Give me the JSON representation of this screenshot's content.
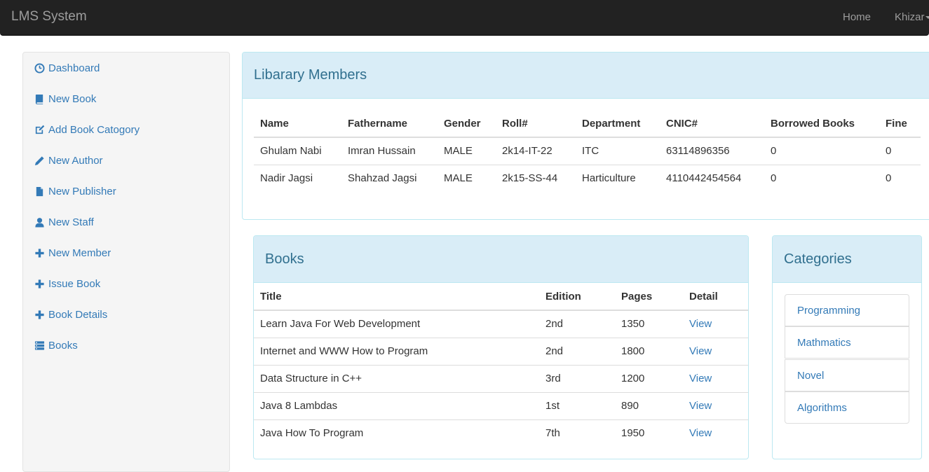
{
  "navbar": {
    "brand": "LMS System",
    "home": "Home",
    "user": "Khizar"
  },
  "sidebar": {
    "items": [
      {
        "label": "Dashboard"
      },
      {
        "label": "New Book"
      },
      {
        "label": "Add Book Catogory"
      },
      {
        "label": "New Author"
      },
      {
        "label": "New Publisher"
      },
      {
        "label": "New Staff"
      },
      {
        "label": "New Member"
      },
      {
        "label": "Issue Book"
      },
      {
        "label": "Book Details"
      },
      {
        "label": "Books"
      }
    ]
  },
  "members": {
    "title": "Libarary Members",
    "headers": [
      "Name",
      "Fathername",
      "Gender",
      "Roll#",
      "Department",
      "CNIC#",
      "Borrowed Books",
      "Fine"
    ],
    "rows": [
      [
        "Ghulam Nabi",
        "Imran Hussain",
        "MALE",
        "2k14-IT-22",
        "ITC",
        "63114896356",
        "0",
        "0"
      ],
      [
        "Nadir Jagsi",
        "Shahzad Jagsi",
        "MALE",
        "2k15-SS-44",
        "Harticulture",
        "4110442454564",
        "0",
        "0"
      ]
    ]
  },
  "books": {
    "title": "Books",
    "headers": [
      "Title",
      "Edition",
      "Pages",
      "Detail"
    ],
    "rows": [
      [
        "Learn Java For Web Development",
        "2nd",
        "1350",
        "View"
      ],
      [
        "Internet and WWW How to Program",
        "2nd",
        "1800",
        "View"
      ],
      [
        "Data Structure in C++",
        "3rd",
        "1200",
        "View"
      ],
      [
        "Java 8 Lambdas",
        "1st",
        "890",
        "View"
      ],
      [
        "Java How To Program",
        "7th",
        "1950",
        "View"
      ]
    ]
  },
  "categories": {
    "title": "Categories",
    "items": [
      "Programming",
      "Mathmatics",
      "Novel",
      "Algorithms"
    ]
  }
}
